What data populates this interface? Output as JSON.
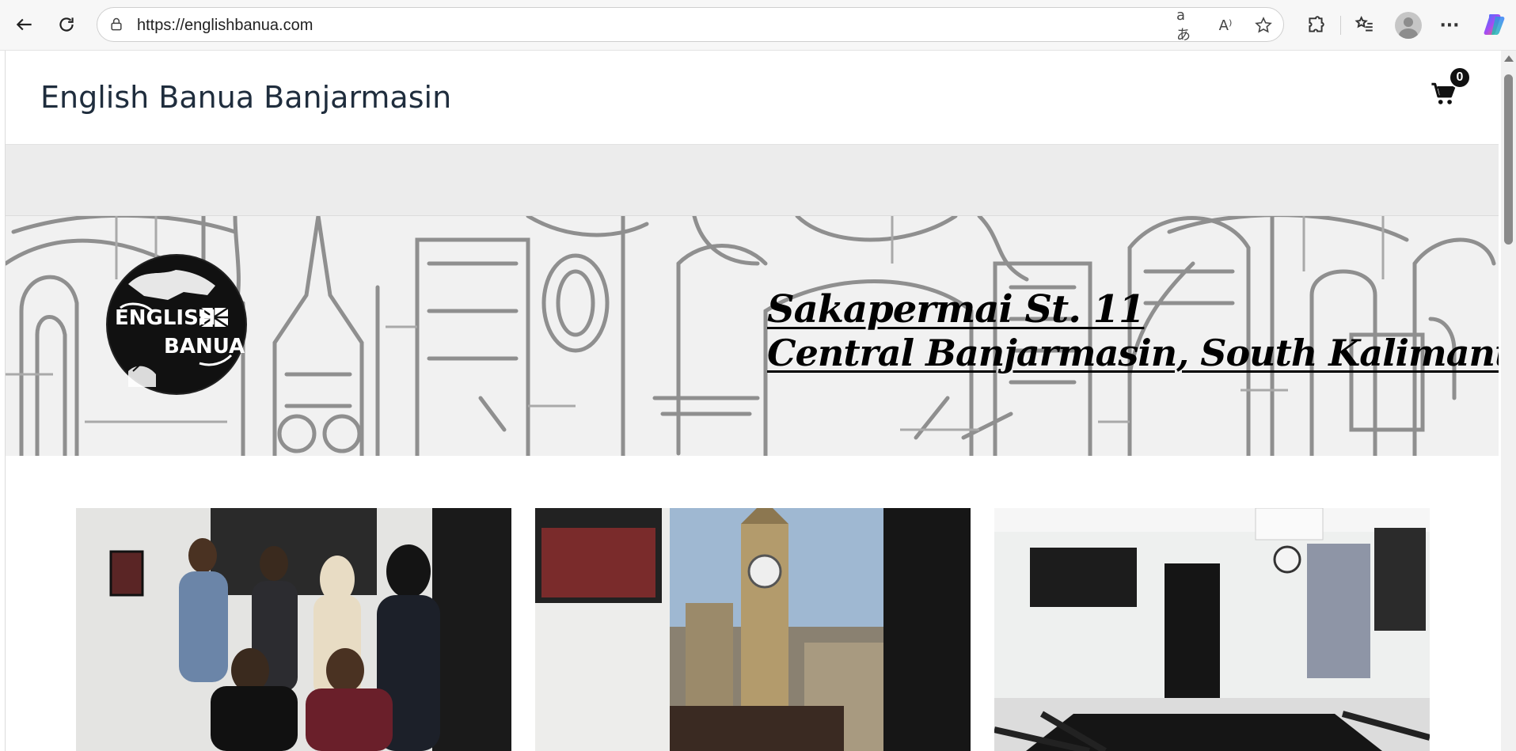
{
  "browser": {
    "url": "https://englishbanua.com",
    "icons": {
      "back": "back-arrow-icon",
      "refresh": "refresh-icon",
      "lock": "lock-icon",
      "translate": "translate-icon",
      "read_aloud": "read-aloud-icon",
      "favorite": "star-icon",
      "extensions": "puzzle-icon",
      "favorites": "favorites-list-icon",
      "profile": "profile-avatar",
      "more": "more-icon",
      "copilot": "copilot-icon"
    },
    "translate_glyph": "aあ",
    "read_aloud_glyph": "A⁾",
    "more_glyph": "···"
  },
  "site": {
    "title": "English Banua Banjarmasin",
    "cart_count": "0",
    "cart_icon": "shopping-cart-icon"
  },
  "banner": {
    "logo_line1": "ENGLISH",
    "logo_line2": "BANUA",
    "address_line1": "Sakapermai St. 11",
    "address_line2": "Central Banjarmasin, South Kalimantan"
  },
  "colors": {
    "title": "#1f2d3d",
    "menu_strip": "#ececec",
    "banner_sketch": "#8f8f8f"
  },
  "gallery": [
    {
      "name": "photo-students-group"
    },
    {
      "name": "photo-big-ben-mural"
    },
    {
      "name": "photo-classroom"
    }
  ]
}
